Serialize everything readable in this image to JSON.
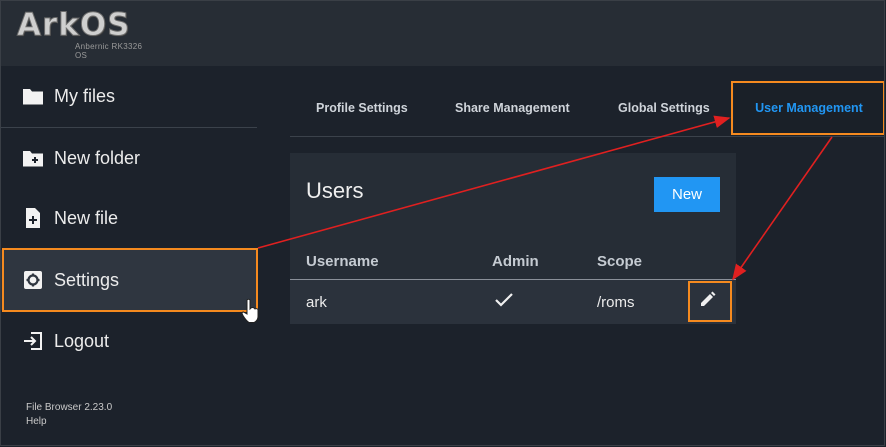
{
  "header": {
    "logo_text": "ArkOS",
    "logo_subtitle": "Anbernic RK3326 OS"
  },
  "sidebar": {
    "items": [
      {
        "label": "My files",
        "icon": "folder-icon"
      },
      {
        "label": "New folder",
        "icon": "folder-plus-icon"
      },
      {
        "label": "New file",
        "icon": "file-plus-icon"
      },
      {
        "label": "Settings",
        "icon": "gear-icon",
        "active": true
      },
      {
        "label": "Logout",
        "icon": "logout-icon"
      }
    ],
    "version": "File Browser 2.23.0",
    "help": "Help"
  },
  "tabs": [
    {
      "label": "Profile Settings"
    },
    {
      "label": "Share Management"
    },
    {
      "label": "Global Settings"
    },
    {
      "label": "User Management",
      "active": true
    }
  ],
  "users_card": {
    "title": "Users",
    "new_label": "New",
    "columns": [
      "Username",
      "Admin",
      "Scope"
    ],
    "rows": [
      {
        "username": "ark",
        "admin": "checkmark-icon",
        "scope": "/roms"
      }
    ]
  },
  "colors": {
    "accent": "#2196f3",
    "highlight": "#f58a1f",
    "annotation_arrow": "#e02020",
    "background": "#1c222b",
    "header": "#272d35"
  }
}
